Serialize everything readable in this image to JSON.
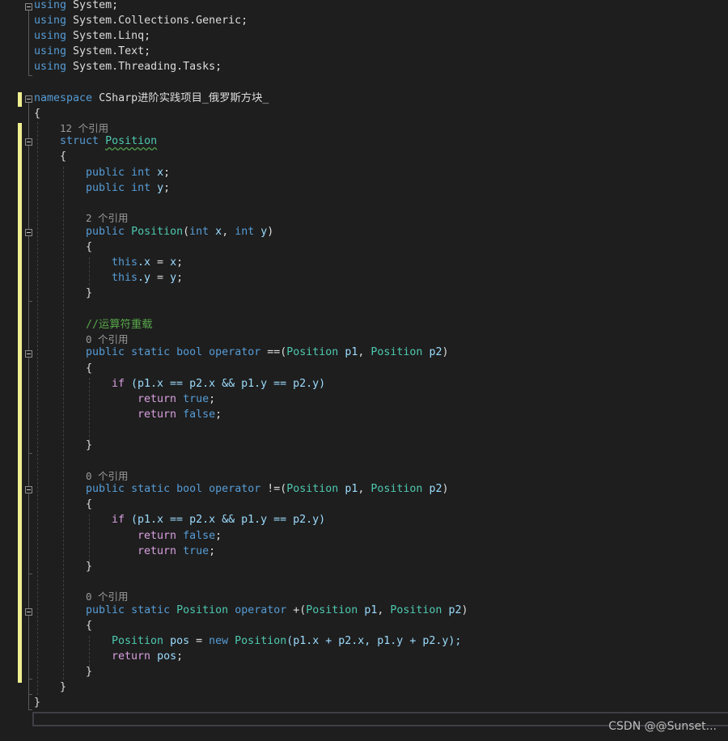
{
  "usings": [
    {
      "kw": "using",
      "name": "System;"
    },
    {
      "kw": "using",
      "name": "System.Collections.Generic;"
    },
    {
      "kw": "using",
      "name": "System.Linq;"
    },
    {
      "kw": "using",
      "name": "System.Text;"
    },
    {
      "kw": "using",
      "name": "System.Threading.Tasks;"
    }
  ],
  "namespace": {
    "kw": "namespace",
    "name": "CSharp进阶实践项目_俄罗斯方块_"
  },
  "struct": {
    "refs": "12 个引用",
    "kw": "struct",
    "name": "Position"
  },
  "fields": [
    {
      "mod": "public",
      "type": "int",
      "name": "x",
      "end": ";"
    },
    {
      "mod": "public",
      "type": "int",
      "name": "y",
      "end": ";"
    }
  ],
  "ctor": {
    "refs": "2 个引用",
    "mod": "public",
    "name": "Position",
    "open": "(",
    "t1": "int",
    "p1": "x",
    "comma": ",",
    "t2": "int",
    "p2": "y",
    "close": ")",
    "body": [
      {
        "this": "this",
        "lhs": ".x",
        "eq": " = ",
        "rhs": "x",
        "end": ";"
      },
      {
        "this": "this",
        "lhs": ".y",
        "eq": " = ",
        "rhs": "y",
        "end": ";"
      }
    ]
  },
  "comment": "//运算符重载",
  "op_eq": {
    "refs": "0 个引用",
    "mod": "public",
    "static": "static",
    "type": "bool",
    "op": "operator",
    "sym": "==(",
    "pt1": "Position",
    "pn1": "p1",
    "comma": ",",
    "pt2": "Position",
    "pn2": "p2",
    "close": ")",
    "if": "if",
    "cond": " (p1.x == p2.x && p1.y == p2.y)",
    "r1kw": "return",
    "r1v": "true",
    "r2kw": "return",
    "r2v": "false",
    "semi": ";"
  },
  "op_neq": {
    "refs": "0 个引用",
    "mod": "public",
    "static": "static",
    "type": "bool",
    "op": "operator",
    "sym": "!=(",
    "pt1": "Position",
    "pn1": "p1",
    "comma": ",",
    "pt2": "Position",
    "pn2": "p2",
    "close": ")",
    "if": "if",
    "cond": " (p1.x == p2.x && p1.y == p2.y)",
    "r1kw": "return",
    "r1v": "false",
    "r2kw": "return",
    "r2v": "true",
    "semi": ";"
  },
  "op_add": {
    "refs": "0 个引用",
    "mod": "public",
    "static": "static",
    "type": "Position",
    "op": "operator",
    "sym": "+(",
    "pt1": "Position",
    "pn1": "p1",
    "comma": ",",
    "pt2": "Position",
    "pn2": "p2",
    "close": ")",
    "l1type": "Position",
    "l1var": "pos",
    "l1eq": " = ",
    "l1new": "new",
    "l1ctor": "Position",
    "l1args": "(p1.x + p2.x, p1.y + p2.y);",
    "l2kw": "return",
    "l2v": "pos",
    "semi": ";"
  },
  "braces": {
    "open": "{",
    "close": "}"
  },
  "watermark": "CSDN @@Sunset...",
  "colors": {
    "background": "#1e1e1e",
    "keyword": "#569cd6",
    "control": "#d8a0df",
    "type": "#4ec9b0",
    "identifier": "#9cdcfe",
    "comment": "#57a64a",
    "codelens": "#999999",
    "change_bar": "#efef91"
  }
}
